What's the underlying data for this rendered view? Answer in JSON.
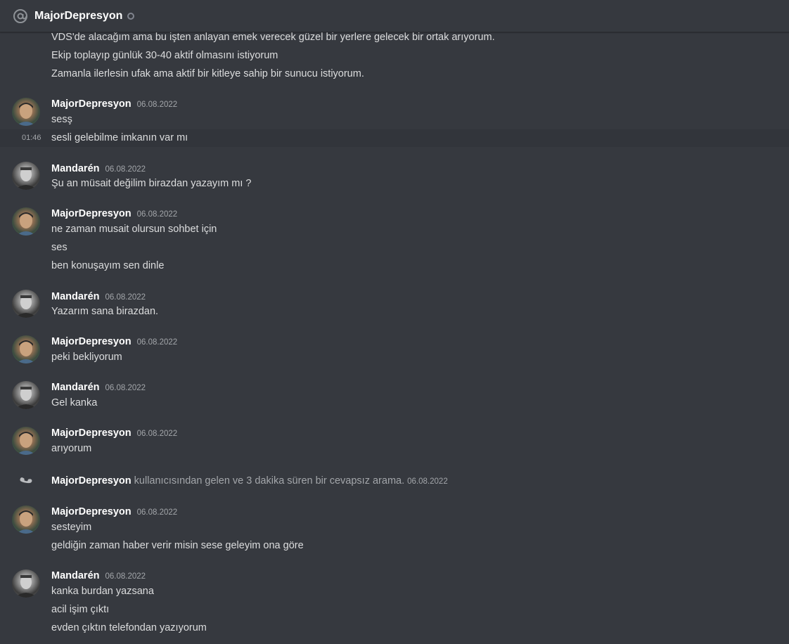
{
  "header": {
    "icon": "at-icon",
    "title": "MajorDepresyon"
  },
  "intro_lines": [
    "VDS'de alacağım ama bu işten anlayan emek verecek güzel bir yerlere gelecek bir ortak arıyorum.",
    "Ekip toplayıp günlük 30-40 aktif olmasını istiyorum",
    "Zamanla ilerlesin ufak ama aktif bir kitleye sahip bir sunucu istiyorum."
  ],
  "groups": [
    {
      "author": "MajorDepresyon",
      "date": "06.08.2022",
      "lines": [
        "sesş"
      ]
    },
    {
      "hover_time": "01:46",
      "line": "sesli gelebilme imkanın var mı"
    },
    {
      "author": "Mandarén",
      "date": "06.08.2022",
      "lines": [
        "Şu an müsait değilim birazdan yazayım mı ?"
      ]
    },
    {
      "author": "MajorDepresyon",
      "date": "06.08.2022",
      "lines": [
        "ne zaman musait olursun sohbet için",
        "ses",
        "ben konuşayım sen dinle"
      ]
    },
    {
      "author": "Mandarén",
      "date": "06.08.2022",
      "lines": [
        "Yazarım sana birazdan."
      ]
    },
    {
      "author": "MajorDepresyon",
      "date": "06.08.2022",
      "lines": [
        "peki bekliyorum"
      ]
    },
    {
      "author": "Mandarén",
      "date": "06.08.2022",
      "lines": [
        "Gel kanka"
      ]
    },
    {
      "author": "MajorDepresyon",
      "date": "06.08.2022",
      "lines": [
        "arıyorum"
      ]
    },
    {
      "call": true,
      "author": "MajorDepresyon",
      "text": "kullanıcısından gelen ve 3 dakika süren bir cevapsız arama.",
      "date": "06.08.2022"
    },
    {
      "author": "MajorDepresyon",
      "date": "06.08.2022",
      "lines": [
        "sesteyim",
        "geldiğin zaman haber verir misin sese geleyim ona göre"
      ]
    },
    {
      "author": "Mandarén",
      "date": "06.08.2022",
      "lines": [
        "kanka burdan yazsana",
        "acil işim çıktı",
        "evden çıktın telefondan yazıyorum"
      ]
    }
  ],
  "colors": {
    "background": "#36393f",
    "text": "#dcddde",
    "author": "#ffffff",
    "muted": "#a3a6aa"
  }
}
